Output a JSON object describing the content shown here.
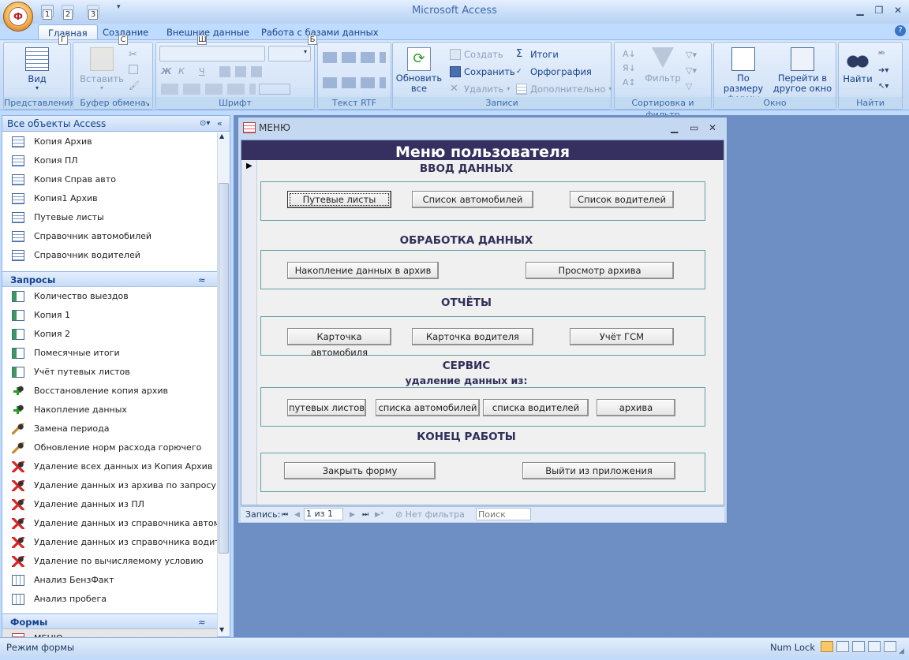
{
  "app": {
    "title": "Microsoft Access",
    "office_icon_label": "Ф"
  },
  "keytips": {
    "qat1": "1",
    "qat2": "2",
    "qat3": "3",
    "home": "Г",
    "create": "С",
    "external": "Ш",
    "database": "Б"
  },
  "tabs": [
    {
      "label": "Главная",
      "active": true
    },
    {
      "label": "Создание"
    },
    {
      "label": "Внешние данные"
    },
    {
      "label": "Работа с базами данных"
    }
  ],
  "ribbon": {
    "views": {
      "label": "Представления",
      "view_btn": "Вид"
    },
    "clipboard": {
      "label": "Буфер обмена",
      "paste_btn": "Вставить"
    },
    "font": {
      "label": "Шрифт",
      "bold": "Ж",
      "italic": "К",
      "underline": "Ч"
    },
    "rtf": {
      "label": "Текст RTF"
    },
    "records": {
      "label": "Записи",
      "refresh_btn": "Обновить все",
      "new": "Создать",
      "save": "Сохранить",
      "delete": "Удалить",
      "totals": "Итоги",
      "spelling": "Орфография",
      "more": "Дополнительно"
    },
    "sort": {
      "label": "Сортировка и фильтр",
      "filter_btn": "Фильтр"
    },
    "window": {
      "label": "Окно",
      "fit_btn": "По размеру формы",
      "switch_btn": "Перейти в другое окно"
    },
    "find": {
      "label": "Найти",
      "find_btn": "Найти"
    }
  },
  "nav": {
    "header": "Все объекты Access",
    "tables": [
      "Копия Архив",
      "Копия ПЛ",
      "Копия Справ авто",
      "Копия1 Архив",
      "Путевые листы",
      "Справочник автомобилей",
      "Справочник водителей"
    ],
    "queries_label": "Запросы",
    "queries": [
      {
        "label": "Количество выездов",
        "icon": "select-query-icon"
      },
      {
        "label": "Копия 1",
        "icon": "select-query-icon"
      },
      {
        "label": "Копия 2",
        "icon": "select-query-icon"
      },
      {
        "label": "Помесячные итоги",
        "icon": "select-query-icon"
      },
      {
        "label": "Учёт путевых листов",
        "icon": "select-query-icon"
      },
      {
        "label": "Восстановление копия архив",
        "icon": "append-query-icon"
      },
      {
        "label": "Накопление данных",
        "icon": "append-query-icon"
      },
      {
        "label": "Замена периода",
        "icon": "update-query-icon"
      },
      {
        "label": "Обновление норм расхода горючего",
        "icon": "update-query-icon"
      },
      {
        "label": "Удаление всех данных из Копия Архив",
        "icon": "delete-query-icon"
      },
      {
        "label": "Удаление данных из архива по запросу",
        "icon": "delete-query-icon"
      },
      {
        "label": "Удаление данных из ПЛ",
        "icon": "delete-query-icon"
      },
      {
        "label": "Удаление данных из справочника автом...",
        "icon": "delete-query-icon"
      },
      {
        "label": "Удаление данных из справочника водит...",
        "icon": "delete-query-icon"
      },
      {
        "label": "Удаление по вычисляемому условию",
        "icon": "delete-query-icon"
      },
      {
        "label": "Анализ БензФакт",
        "icon": "crosstab-query-icon"
      },
      {
        "label": "Анализ пробега",
        "icon": "crosstab-query-icon"
      }
    ],
    "forms_label": "Формы",
    "forms": [
      "МЕНЮ"
    ]
  },
  "form": {
    "window_title": "МЕНЮ",
    "header": "Меню пользователя",
    "sections": {
      "input": "ВВОД ДАННЫХ",
      "processing": "ОБРАБОТКА ДАННЫХ",
      "reports": "ОТЧЁТЫ",
      "service": "СЕРВИС",
      "service_sub": "удаление данных из:",
      "end": "КОНЕЦ РАБОТЫ"
    },
    "buttons": {
      "waybills": "Путевые листы",
      "cars_list": "Список автомобилей",
      "drivers_list": "Список водителей",
      "archive_accumulate": "Накопление данных в архив",
      "archive_view": "Просмотр архива",
      "car_card": "Карточка автомобиля",
      "driver_card": "Карточка водителя",
      "fuel_report": "Учёт ГСМ",
      "del_waybills": "путевых листов",
      "del_cars": "списка автомобилей",
      "del_drivers": "списка водителей",
      "del_archive": "архива",
      "close_form": "Закрыть форму",
      "exit_app": "Выйти из приложения"
    },
    "record_nav": {
      "label": "Запись:",
      "position": "1 из 1",
      "filter": "Нет фильтра",
      "search_placeholder": "Поиск"
    }
  },
  "status": {
    "mode": "Режим формы",
    "numlock": "Num Lock"
  }
}
